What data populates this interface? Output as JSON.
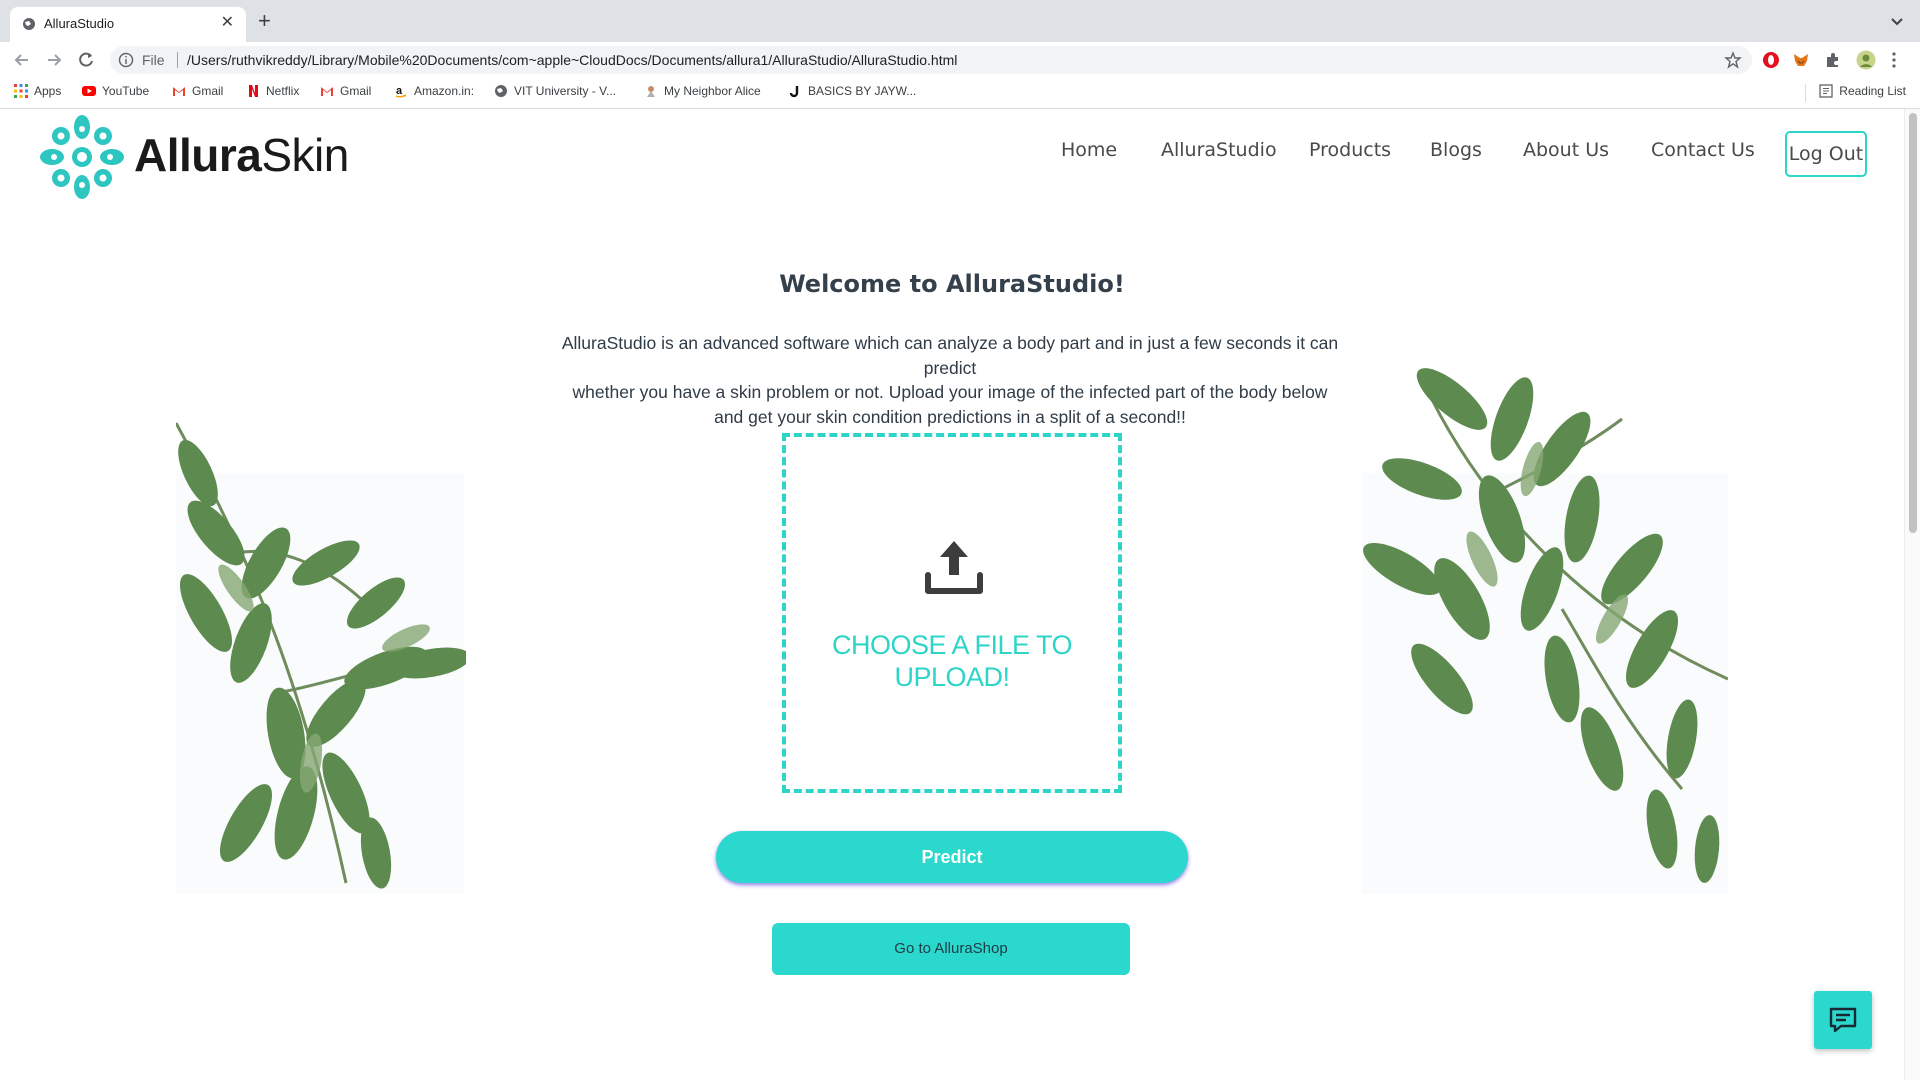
{
  "browser": {
    "tab_title": "AlluraStudio",
    "url_scheme": "File",
    "url": "/Users/ruthvikreddy/Library/Mobile%20Documents/com~apple~CloudDocs/Documents/allura1/AlluraStudio/AlluraStudio.html",
    "bookmarks": [
      {
        "label": "Apps",
        "icon": "apps-grid-icon"
      },
      {
        "label": "YouTube",
        "icon": "youtube-icon"
      },
      {
        "label": "Gmail",
        "icon": "gmail-icon"
      },
      {
        "label": "Netflix",
        "icon": "netflix-icon"
      },
      {
        "label": "Gmail",
        "icon": "gmail-icon"
      },
      {
        "label": "Amazon.in:",
        "icon": "amazon-icon"
      },
      {
        "label": "VIT University - V...",
        "icon": "globe-icon"
      },
      {
        "label": "My Neighbor Alice",
        "icon": "alice-icon"
      },
      {
        "label": "BASICS BY JAYW...",
        "icon": "j-icon"
      }
    ],
    "reading_list": "Reading List"
  },
  "site": {
    "brand_bold": "Allura",
    "brand_light": "Skin",
    "nav": [
      "Home",
      "AlluraStudio",
      "Products",
      "Blogs",
      "About Us",
      "Contact Us"
    ],
    "logout": "Log Out",
    "accent": "#2dd4c8"
  },
  "main": {
    "welcome": "Welcome to AlluraStudio!",
    "intro_lines": [
      "AlluraStudio is an advanced software which can analyze a body part and in just a few seconds it can predict",
      "whether you have a skin problem or not. Upload your image of the infected part of the body below",
      "and get your skin condition predictions in a split of a second!!"
    ],
    "upload_lines": [
      "CHOOSE A FILE TO",
      "UPLOAD!"
    ],
    "predict": "Predict",
    "shop": "Go to AlluraShop"
  }
}
